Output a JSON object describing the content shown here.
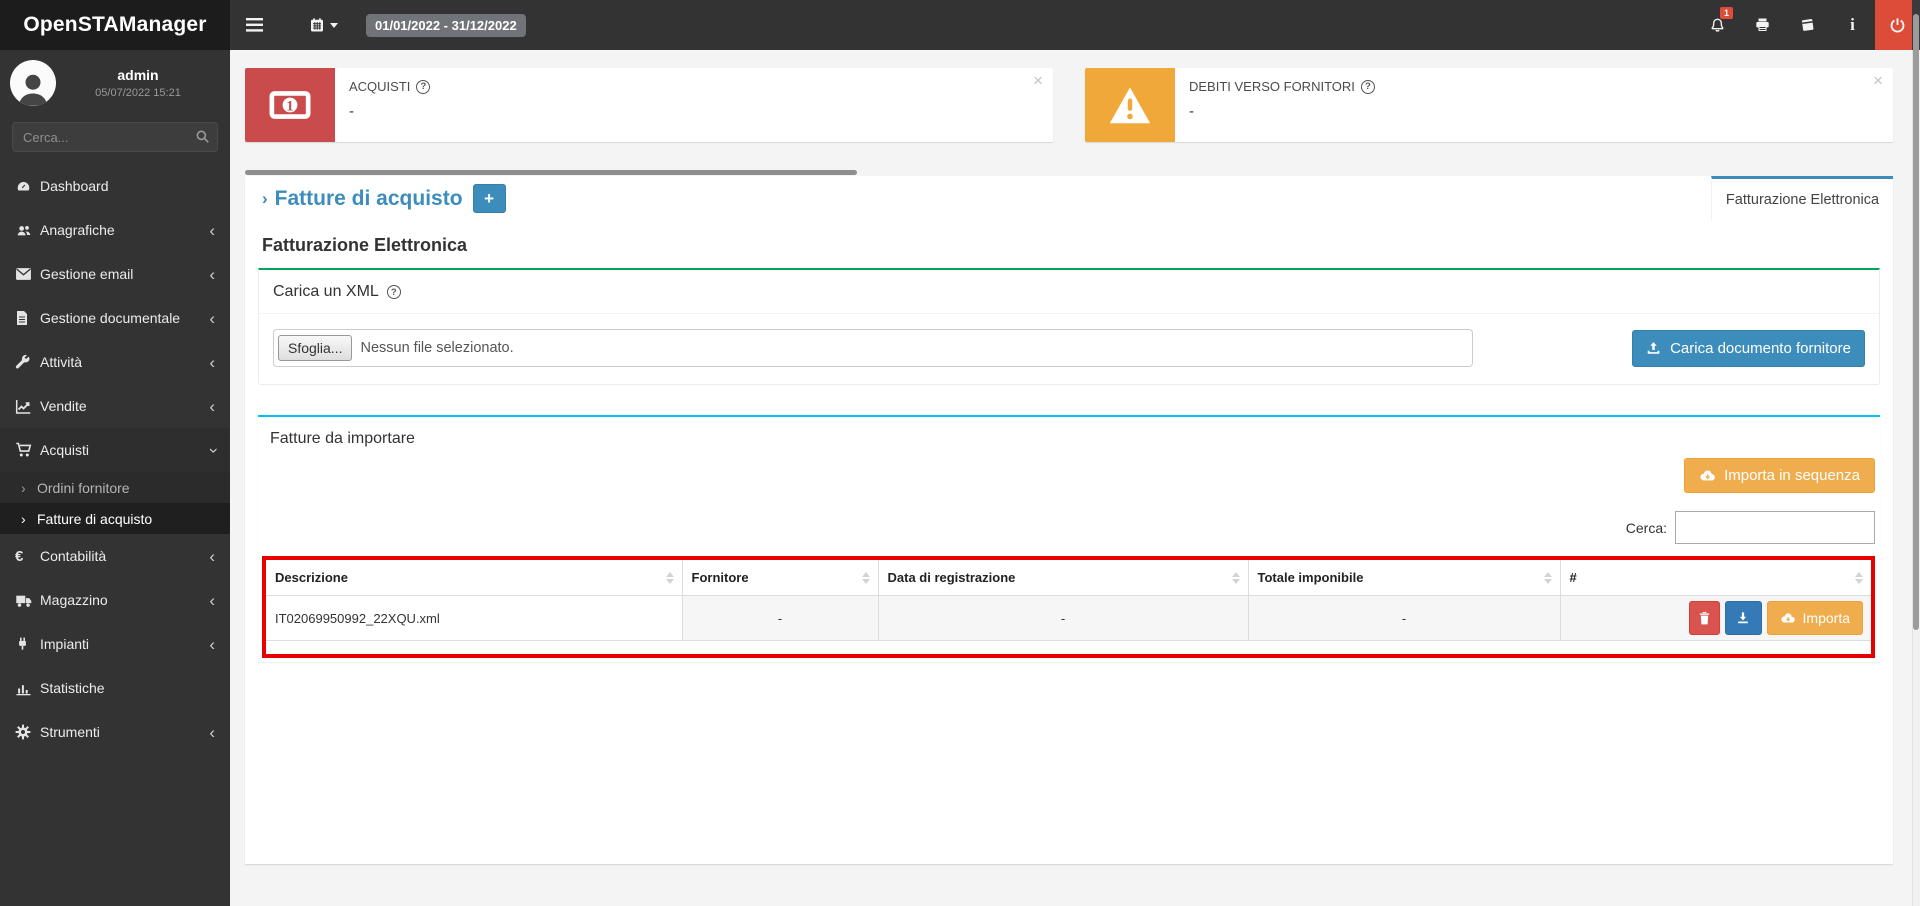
{
  "colors": {
    "primary": "#3c8dbc",
    "success": "#00a65a",
    "info": "#00c0ef",
    "warning": "#f0ad4e",
    "danger": "#dd4b39",
    "highlight_border": "#e80000"
  },
  "icons": {
    "help": "?",
    "close": "×",
    "chevron": "‹",
    "arrow": "›"
  },
  "navbar": {
    "app_title": "OpenSTAManager",
    "date_range": "01/01/2022 - 31/12/2022",
    "notification_count": "1"
  },
  "sidebar": {
    "user": {
      "name": "admin",
      "login_time": "05/07/2022 15:21"
    },
    "search_placeholder": "Cerca...",
    "menu": [
      {
        "label": "Dashboard"
      },
      {
        "label": "Anagrafiche"
      },
      {
        "label": "Gestione email"
      },
      {
        "label": "Gestione documentale"
      },
      {
        "label": "Attività"
      },
      {
        "label": "Vendite"
      },
      {
        "label": "Acquisti",
        "expanded": true,
        "children": [
          {
            "label": "Ordini fornitore"
          },
          {
            "label": "Fatture di acquisto",
            "active": true
          }
        ]
      },
      {
        "label": "Contabilità"
      },
      {
        "label": "Magazzino"
      },
      {
        "label": "Impianti"
      },
      {
        "label": "Statistiche"
      },
      {
        "label": "Strumenti"
      }
    ]
  },
  "info_boxes": [
    {
      "label": "ACQUISTI",
      "value": "-"
    },
    {
      "label": "DEBITI VERSO FORNITORI",
      "value": "-"
    }
  ],
  "page": {
    "title": "Fatture di acquisto",
    "add_button": "+",
    "tab": "Fatturazione Elettronica",
    "section_title": "Fatturazione Elettronica",
    "upload": {
      "title": "Carica un XML",
      "browse_button": "Sfoglia...",
      "file_status": "Nessun file selezionato.",
      "submit_button": "Carica documento fornitore"
    },
    "import": {
      "title": "Fatture da importare",
      "bulk_button": "Importa in sequenza",
      "search_label": "Cerca:",
      "search_value": "",
      "table": {
        "headers": [
          "Descrizione",
          "Fornitore",
          "Data di registrazione",
          "Totale imponibile",
          "#"
        ],
        "row": {
          "descrizione": "IT02069950992_22XQU.xml",
          "fornitore": "-",
          "data_di_registrazione": "-",
          "totale_imponibile": "-",
          "import_button": "Importa"
        }
      }
    }
  }
}
